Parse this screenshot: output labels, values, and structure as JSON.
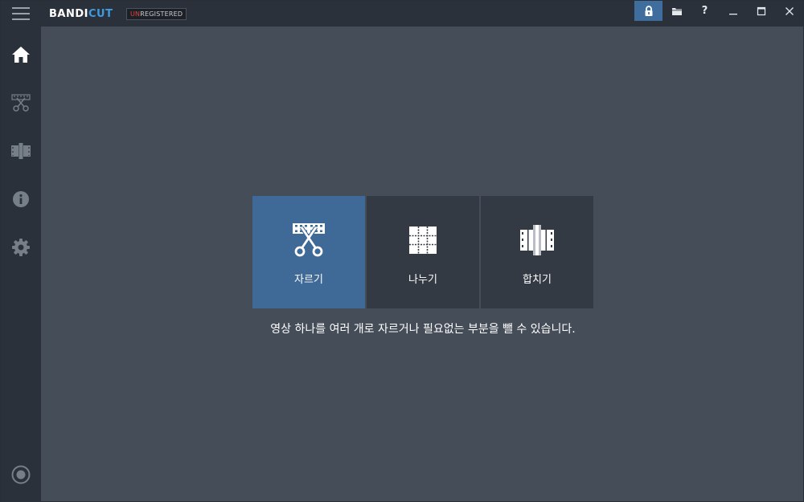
{
  "app": {
    "logo_part1": "BANDI",
    "logo_part2": "CUT",
    "badge_un": "UN",
    "badge_rest": "REGISTERED"
  },
  "titlebar_buttons": [
    {
      "name": "lock-icon",
      "active": true
    },
    {
      "name": "folder-icon"
    },
    {
      "name": "help-icon",
      "label": "?"
    },
    {
      "name": "minimize-icon"
    },
    {
      "name": "maximize-icon"
    },
    {
      "name": "close-icon"
    }
  ],
  "sidebar": {
    "items": [
      "home-icon",
      "cut-icon",
      "join-icon",
      "info-icon",
      "settings-icon",
      "record-icon"
    ]
  },
  "tiles": [
    {
      "label": "자르기",
      "icon": "scissors-film-icon",
      "active": true
    },
    {
      "label": "나누기",
      "icon": "split-grid-icon",
      "active": false
    },
    {
      "label": "합치기",
      "icon": "join-film-icon",
      "active": false
    }
  ],
  "description": "영상 하나를 여러 개로 자르거나 필요없는 부분을 뺄 수 있습니다.",
  "colors": {
    "accent": "#3f6996",
    "logo_cut": "#3f9be0",
    "badge_un": "#e0443a",
    "background": "#454d58",
    "sidebar": "#2b313a"
  }
}
